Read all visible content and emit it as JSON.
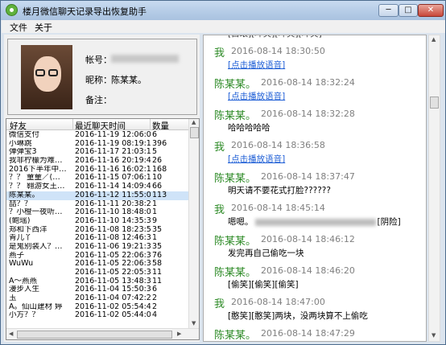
{
  "window": {
    "title": "楼月微信聊天记录导出恢复助手",
    "controls": {
      "min": "─",
      "max": "□",
      "close": "✕"
    }
  },
  "menubar": {
    "file": "文件",
    "about": "关于"
  },
  "profile": {
    "account_label": "帐号：",
    "nick_label": "昵称：",
    "nick_value": "陈某某。",
    "note_label": "备注："
  },
  "friends": {
    "headers": [
      "好友",
      "最近聊天时间",
      "数量"
    ],
    "rows": [
      {
        "name": "微信支付",
        "time": "2016-11-19 12:06:00",
        "count": "6"
      },
      {
        "name": "小琳跳",
        "time": "2016-11-19 08:19:19",
        "count": "396"
      },
      {
        "name": "弹弹宝3",
        "time": "2016-11-17 21:03:12",
        "count": "5"
      },
      {
        "name": "我非柠檬为难…",
        "time": "2016-11-16 20:19:45",
        "count": "26"
      },
      {
        "name": "2016下半年中…",
        "time": "2016-11-16 16:02:13",
        "count": "168"
      },
      {
        "name": "？？ 童童／(…",
        "time": "2016-11-15 07:06:13",
        "count": "10"
      },
      {
        "name": "？？ 翱游女王…",
        "time": "2016-11-14 14:09:46",
        "count": "66"
      },
      {
        "name": "陈某某。",
        "time": "2016-11-12 11:55:01",
        "count": "113"
      },
      {
        "name": "喆？？",
        "time": "2016-11-11 20:38:20",
        "count": "1"
      },
      {
        "name": "？小橙一夜听…",
        "time": "2016-11-10 18:48:06",
        "count": "1"
      },
      {
        "name": "(鲍瑶)",
        "time": "2016-11-10 14:35:38",
        "count": "9"
      },
      {
        "name": "郑和下西洋",
        "time": "2016-11-08 18:23:55",
        "count": "35"
      },
      {
        "name": "青儿丫",
        "time": "2016-11-08 12:46:33",
        "count": "1"
      },
      {
        "name": "是鬼别装人？…",
        "time": "2016-11-06 19:21:32",
        "count": "35"
      },
      {
        "name": "燕子",
        "time": "2016-11-05 22:06:35",
        "count": "76"
      },
      {
        "name": "WuWu",
        "time": "2016-11-05 22:06:35",
        "count": "58"
      },
      {
        "name": "",
        "time": "2016-11-05 22:05:32",
        "count": "11"
      },
      {
        "name": "A～燕燕",
        "time": "2016-11-05 13:48:37",
        "count": "11"
      },
      {
        "name": "漫步人生",
        "time": "2016-11-04 15:50:31",
        "count": "6"
      },
      {
        "name": "玉",
        "time": "2016-11-04 07:42:27",
        "count": "2"
      },
      {
        "name": "A。仙山建材 婷",
        "time": "2016-11-02 05:54:40",
        "count": "2"
      },
      {
        "name": "小方？？",
        "time": "2016-11-02 05:44:08",
        "count": "4"
      }
    ],
    "selected_row": 7
  },
  "chat": {
    "top_cut": "[白眼][坏笑][坏笑][坏笑]",
    "voice_link": "[点击播放语音]",
    "messages": [
      {
        "sender": "我",
        "time": "2016-08-14 18:30:50",
        "body_type": "voice"
      },
      {
        "sender": "陈某某。",
        "time": "2016-08-14 18:32:24",
        "body_type": "voice"
      },
      {
        "sender": "陈某某。",
        "time": "2016-08-14 18:32:28",
        "body_type": "text",
        "text": "哈哈哈哈哈"
      },
      {
        "sender": "我",
        "time": "2016-08-14 18:36:58",
        "body_type": "voice"
      },
      {
        "sender": "陈某某。",
        "time": "2016-08-14 18:37:47",
        "body_type": "text",
        "text": "明天请不要花式打脸??????"
      },
      {
        "sender": "我",
        "time": "2016-08-14 18:45:14",
        "body_type": "blur",
        "text": "嗯嗯。",
        "text_end": "[阴险]"
      },
      {
        "sender": "陈某某。",
        "time": "2016-08-14 18:46:12",
        "body_type": "text",
        "text": "发完再自己偷吃一块"
      },
      {
        "sender": "陈某某。",
        "time": "2016-08-14 18:46:20",
        "body_type": "text",
        "text": "[偷笑][偷笑][偷笑]"
      },
      {
        "sender": "我",
        "time": "2016-08-14 18:47:00",
        "body_type": "text",
        "text": "[憨笑][憨笑]两块，没两块算不上偷吃"
      },
      {
        "sender": "陈某某。",
        "time": "2016-08-14 18:47:29",
        "body_type": "text",
        "text": ""
      }
    ]
  }
}
